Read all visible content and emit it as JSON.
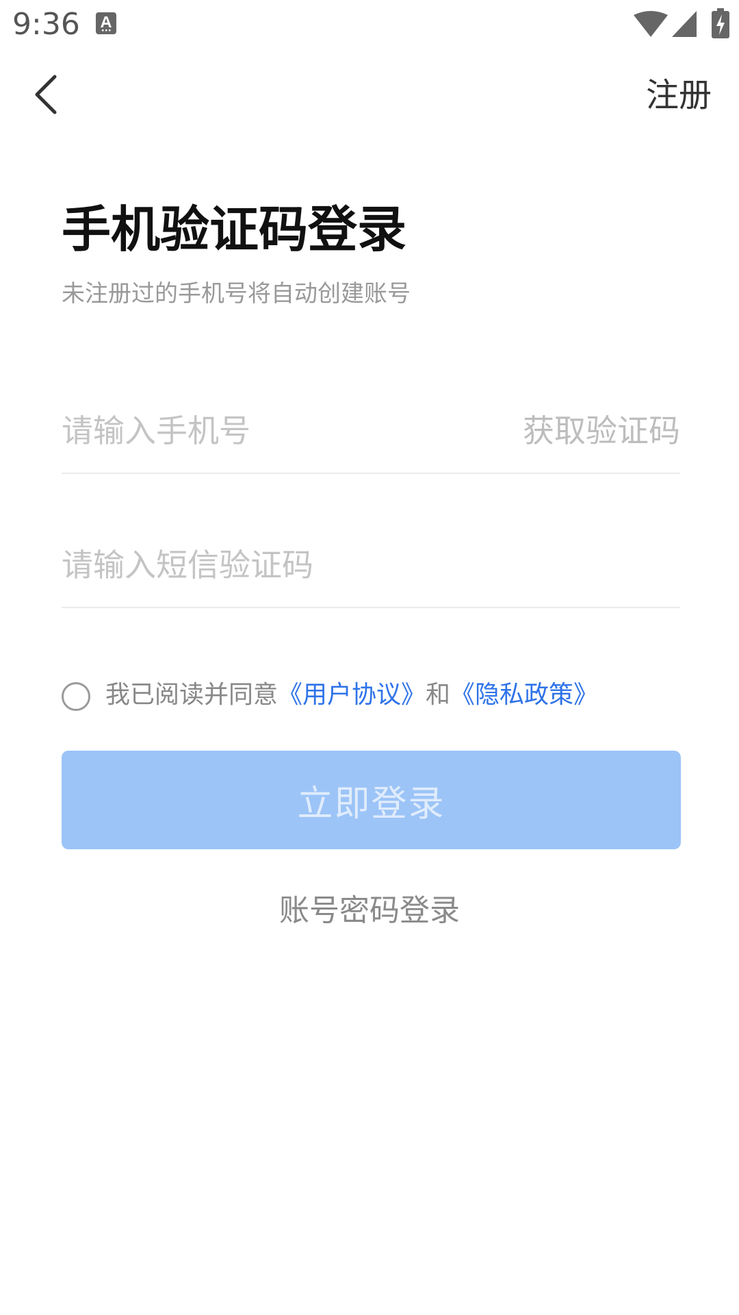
{
  "status_bar": {
    "time": "9:36",
    "icons": [
      "keyboard-a-icon",
      "wifi-icon",
      "signal-icon",
      "battery-charging-icon"
    ]
  },
  "header": {
    "back_icon": "chevron-left-icon",
    "register_label": "注册"
  },
  "title": "手机验证码登录",
  "subtitle": "未注册过的手机号将自动创建账号",
  "phone_field": {
    "placeholder": "请输入手机号",
    "value": "",
    "get_code_label": "获取验证码"
  },
  "code_field": {
    "placeholder": "请输入短信验证码",
    "value": ""
  },
  "agreement": {
    "checked": false,
    "prefix": "我已阅读并同意",
    "user_agreement": "《用户协议》",
    "conjunction": "和",
    "privacy_policy": "《隐私政策》"
  },
  "login_button_label": "立即登录",
  "password_login_label": "账号密码登录",
  "colors": {
    "link": "#2f73e8",
    "button_disabled_bg": "#9cc4f7",
    "button_disabled_text": "#e0ecfc",
    "placeholder": "#c4c4c4",
    "muted_text": "#999999"
  }
}
